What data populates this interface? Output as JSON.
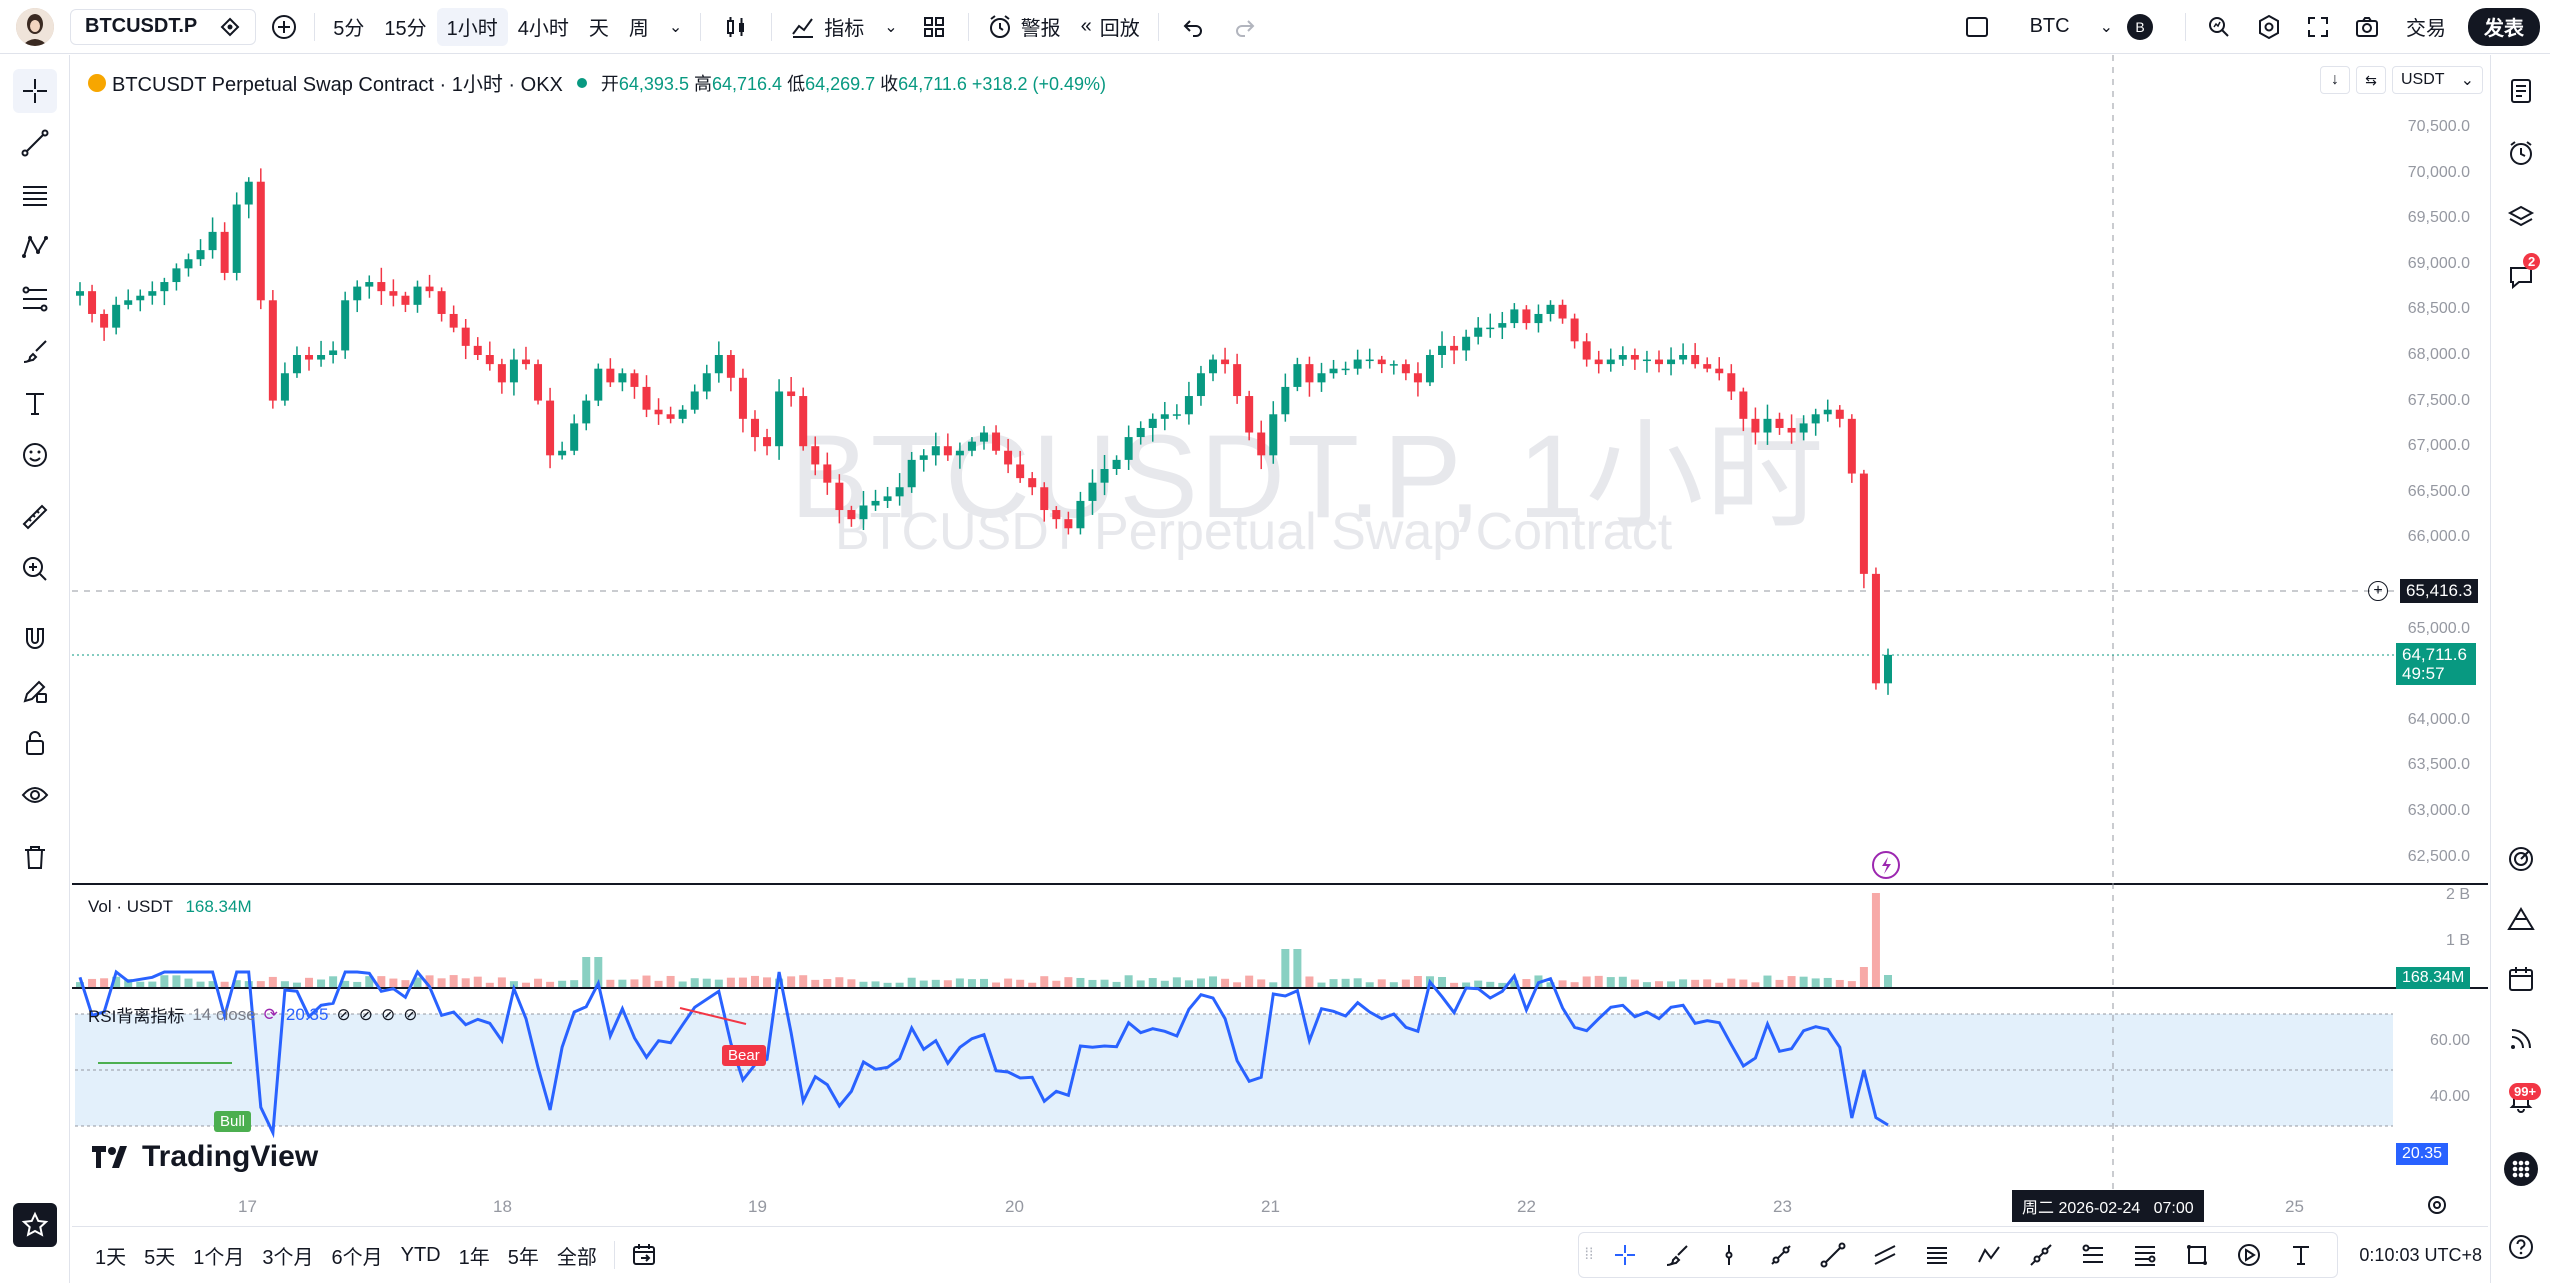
{
  "topbar": {
    "symbol": "BTCUSDT.P",
    "intervals": [
      "5分",
      "15分",
      "1小时",
      "4小时",
      "天",
      "周"
    ],
    "active_interval": "1小时",
    "indicators_label": "指标",
    "alert_label": "警报",
    "replay_label": "回放",
    "asset": "BTC",
    "asset_badge": "B",
    "trade_label": "交易",
    "publish_label": "发表"
  },
  "legend": {
    "title": "BTCUSDT Perpetual Swap Contract · 1小时 · OKX",
    "open_label": "开",
    "open": "64,393.5",
    "high_label": "高",
    "high": "64,716.4",
    "low_label": "低",
    "low": "64,269.7",
    "close_label": "收",
    "close": "64,711.6",
    "change": "+318.2 (+0.49%)",
    "currency": "USDT"
  },
  "watermark": {
    "line1": "BTCUSDT.P, 1小时",
    "line2": "BTCUSDT Perpetual Swap Contract"
  },
  "price_axis": [
    "70,500.0",
    "70,000.0",
    "69,500.0",
    "69,000.0",
    "68,500.0",
    "68,000.0",
    "67,500.0",
    "67,000.0",
    "66,500.0",
    "66,000.0",
    "65,000.0",
    "64,000.0",
    "63,500.0",
    "63,000.0",
    "62,500.0"
  ],
  "crosshair_price": "65,416.3",
  "last_price": "64,711.6",
  "countdown": "49:57",
  "volume": {
    "label": "Vol · USDT",
    "value": "168.34M",
    "axis": [
      "2 B",
      "1 B"
    ],
    "last_label": "168.34M"
  },
  "rsi": {
    "label": "RSI背离指标",
    "params": "14 close",
    "value": "20.35",
    "axis": [
      "60.00",
      "40.00"
    ],
    "bull_label": "Bull",
    "bear_label": "Bear",
    "last_label": "20.35"
  },
  "x_axis": [
    "17",
    "18",
    "19",
    "20",
    "21",
    "22",
    "23",
    "25"
  ],
  "crosshair_time": "周二 2026-02-24   07:00",
  "logo_text": "TradingView",
  "bottombar": {
    "ranges": [
      "1天",
      "5天",
      "1个月",
      "3个月",
      "6个月",
      "YTD",
      "1年",
      "5年",
      "全部"
    ],
    "clock": "0:10:03 UTC+8"
  },
  "badges": {
    "chat": "2",
    "notifications": "99+"
  },
  "colors": {
    "up": "#089981",
    "down": "#f23645",
    "rsi_line": "#2962ff",
    "rsi_band": "#e3f0fb"
  },
  "chart_data": {
    "type": "candlestick",
    "title": "BTCUSDT Perpetual Swap Contract · 1小时 · OKX",
    "ylim": [
      62300,
      70700
    ],
    "x_ticks": [
      "17",
      "18",
      "19",
      "20",
      "21",
      "22",
      "23",
      "25"
    ],
    "close_series": [
      68700,
      68450,
      68300,
      68550,
      68600,
      68650,
      68700,
      68800,
      68950,
      69050,
      69150,
      69350,
      68900,
      69650,
      69900,
      68600,
      67500,
      67800,
      68000,
      67950,
      68000,
      68050,
      68600,
      68750,
      68800,
      68700,
      68650,
      68550,
      68750,
      68700,
      68450,
      68300,
      68100,
      68000,
      67900,
      67700,
      67950,
      67900,
      67500,
      66900,
      66950,
      67250,
      67500,
      67850,
      67700,
      67800,
      67650,
      67400,
      67350,
      67300,
      67400,
      67600,
      67800,
      68000,
      67750,
      67300,
      67100,
      67000,
      67600,
      67550,
      67000,
      66800,
      66600,
      66300,
      66200,
      66350,
      66400,
      66450,
      66550,
      66850,
      66900,
      67000,
      66900,
      66950,
      67050,
      67150,
      66950,
      66800,
      66650,
      66550,
      66300,
      66200,
      66100,
      66400,
      66600,
      66750,
      66850,
      67100,
      67200,
      67300,
      67350,
      67350,
      67550,
      67800,
      67950,
      67900,
      67550,
      67150,
      66900,
      67350,
      67650,
      67900,
      67700,
      67800,
      67850,
      67850,
      67950,
      67950,
      67900,
      67900,
      67800,
      67700,
      68000,
      68100,
      68050,
      68200,
      68300,
      68300,
      68350,
      68500,
      68350,
      68450,
      68550,
      68400,
      68150,
      67950,
      67900,
      67950,
      68000,
      67950,
      67950,
      67900,
      67950,
      68000,
      67900,
      67850,
      67800,
      67600,
      67300,
      67150,
      67300,
      67200,
      67150,
      67250,
      67350,
      67400,
      67300,
      66700,
      65600,
      64400,
      64712
    ],
    "volume_last": "168.34M",
    "rsi_last": 20.35
  }
}
